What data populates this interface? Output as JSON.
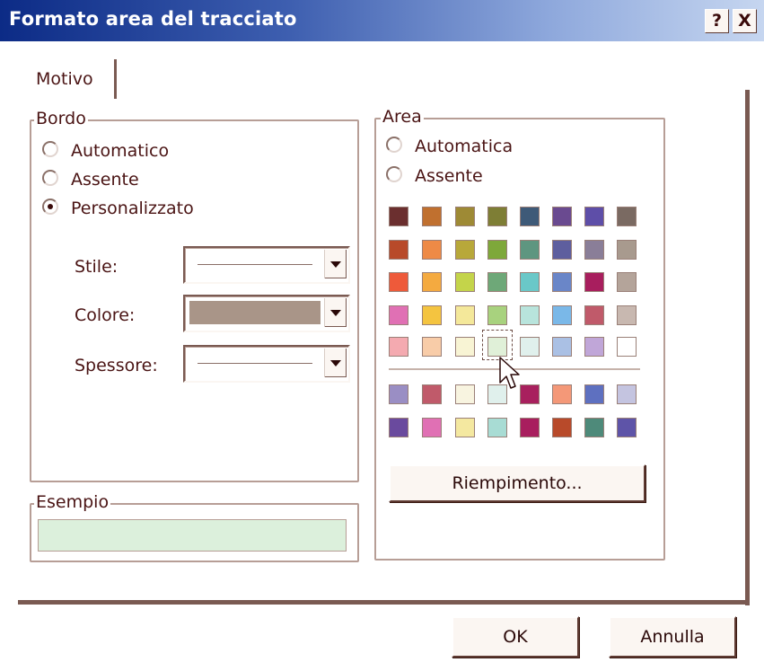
{
  "window": {
    "title": "Formato area del tracciato",
    "help_btn": "?",
    "close_btn": "X"
  },
  "tabs": [
    {
      "label": "Motivo"
    }
  ],
  "bordo": {
    "legend": "Bordo",
    "options": [
      {
        "label": "Automatico",
        "checked": false
      },
      {
        "label": "Assente",
        "checked": false
      },
      {
        "label": "Personalizzato",
        "checked": true
      }
    ],
    "stile_label": "Stile:",
    "colore_label": "Colore:",
    "colore_value": "#a99588",
    "spessore_label": "Spessore:"
  },
  "esempio": {
    "legend": "Esempio",
    "sample_color": "#dcf0dc"
  },
  "area": {
    "legend": "Area",
    "options": [
      {
        "label": "Automatica",
        "checked": false
      },
      {
        "label": "Assente",
        "checked": false
      }
    ],
    "palette_top": [
      [
        "#6b2f2f",
        "#c0702f",
        "#9e8a35",
        "#7e7e35",
        "#3e5a78",
        "#6a4a90",
        "#5e4ea8",
        "#7a6a62"
      ],
      [
        "#b84a2a",
        "#ee8a46",
        "#b8a83a",
        "#7ea83a",
        "#5e9680",
        "#5e5e9e",
        "#8a7e98",
        "#a89a8e"
      ],
      [
        "#ee5a3a",
        "#f4aa40",
        "#c4d44a",
        "#6ea878",
        "#6ac8c8",
        "#6a86c8",
        "#a81e5e",
        "#b4a49a"
      ],
      [
        "#e070b4",
        "#f4c440",
        "#f4e89a",
        "#a8d27e",
        "#b8e4dc",
        "#7ab8e8",
        "#c05a6a",
        "#c8b8b0"
      ],
      [
        "#f4aab0",
        "#f8cca8",
        "#f8f4d4",
        "#e0f0d8",
        "#e0f0ec",
        "#aac0e4",
        "#c0a6d8",
        "#ffffff"
      ]
    ],
    "palette_custom": [
      [
        "#9a8ec4",
        "#c05a6a",
        "#f8f4e0",
        "#e0f0ec",
        "#a8205e",
        "#f49878",
        "#5e70c0",
        "#c4c4e0"
      ],
      [
        "#6a4a9e",
        "#e070b4",
        "#f4e8a0",
        "#a8dcd4",
        "#a81e5e",
        "#b84a2a",
        "#4e8a7a",
        "#5e54a8"
      ]
    ],
    "fill_button": "Riempimento..."
  },
  "buttons": {
    "ok": "OK",
    "cancel": "Annulla"
  }
}
